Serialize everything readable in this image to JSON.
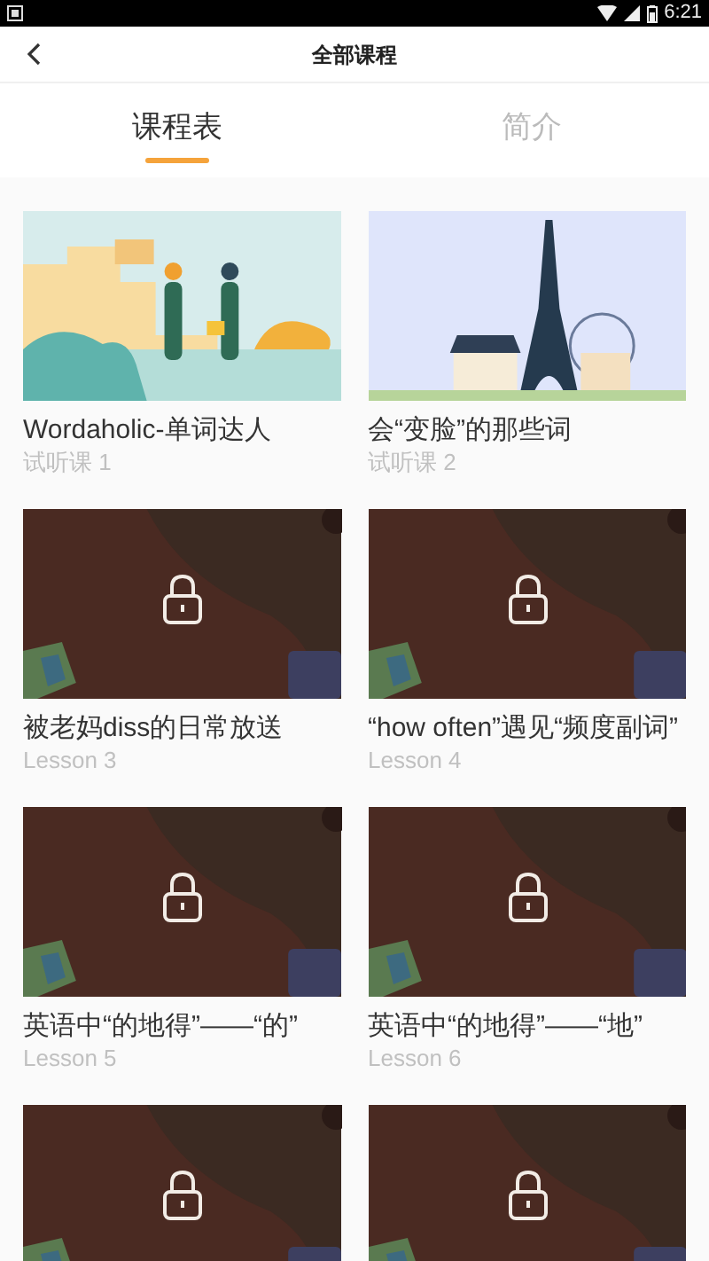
{
  "status_bar": {
    "time": "6:21"
  },
  "header": {
    "title": "全部课程"
  },
  "tabs": [
    {
      "label": "课程表",
      "selected": true
    },
    {
      "label": "简介",
      "selected": false
    }
  ],
  "lessons": [
    {
      "title": "Wordaholic-单词达人",
      "subtitle": "试听课 1",
      "locked": false
    },
    {
      "title": "会“变脸”的那些词",
      "subtitle": "试听课 2",
      "locked": false
    },
    {
      "title": "被老妈diss的日常放送",
      "subtitle": "Lesson 3",
      "locked": true
    },
    {
      "title": "“how often”遇见“频度副词”",
      "subtitle": "Lesson 4",
      "locked": true
    },
    {
      "title": "英语中“的地得”——“的”",
      "subtitle": "Lesson 5",
      "locked": true
    },
    {
      "title": "英语中“的地得”——“地”",
      "subtitle": "Lesson 6",
      "locked": true
    },
    {
      "locked": true
    },
    {
      "locked": true
    }
  ]
}
